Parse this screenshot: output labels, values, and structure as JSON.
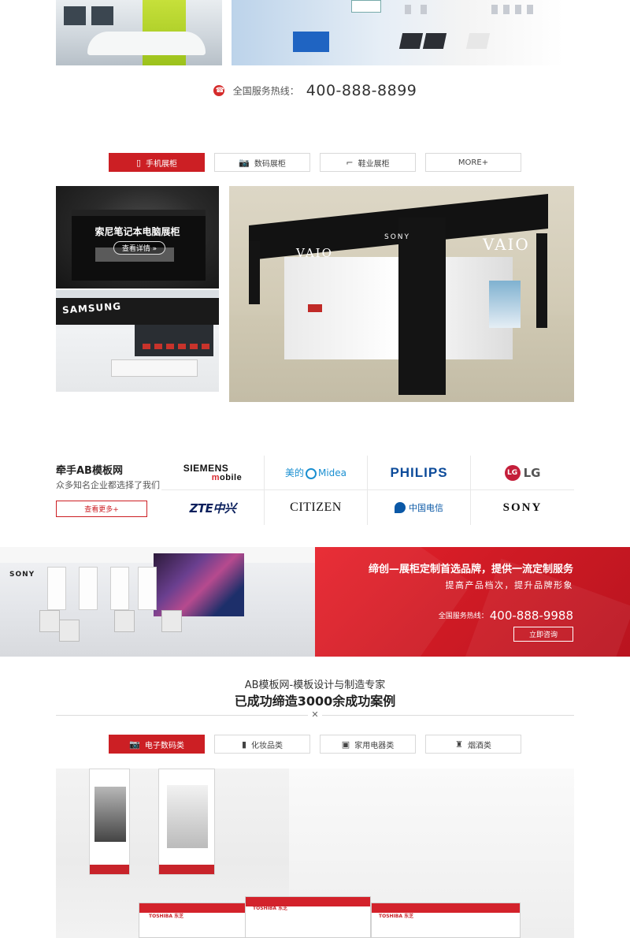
{
  "hotline": {
    "label": "全国服务热线：",
    "number": "400-888-8899"
  },
  "product_tabs": [
    {
      "label": "手机展柜",
      "icon": "mobile-phone-icon",
      "active": true
    },
    {
      "label": "数码展柜",
      "icon": "camera-icon",
      "active": false
    },
    {
      "label": "鞋业展柜",
      "icon": "high-heel-icon",
      "active": false
    },
    {
      "label": "MORE+",
      "icon": "",
      "active": false
    }
  ],
  "showcase": {
    "title": "索尼笔记本电脑展柜",
    "button": "查看详情 »",
    "side_brand": "SAMSUNG",
    "main_brand": "VAIO",
    "main_maker": "SONY"
  },
  "partners": {
    "title": "牵手AB模板网",
    "subtitle": "众多知名企业都选择了我们",
    "button": "查看更多+",
    "logos": {
      "siemens": "SIEMENS",
      "siemens_mobile_m": "m",
      "siemens_mobile_rest": "obile",
      "midea_cn": "美的",
      "midea_en": "Midea",
      "philips": "PHILIPS",
      "lg_mark": "LG",
      "lg": "LG",
      "zte": "ZTE中兴",
      "citizen": "CITIZEN",
      "telecom": "中国电信",
      "sony": "SONY"
    }
  },
  "banner": {
    "headline": "缔创—展柜定制首选品牌，提供一流定制服务",
    "subline": "提高产品档次，提升品牌形象",
    "hotline_label": "全国服务热线：",
    "hotline_number": "400-888-9988",
    "button": "立即咨询",
    "photo_brand": "SONY"
  },
  "cases": {
    "subtitle": "AB模板网-模板设计与制造专家",
    "title": "已成功缔造3000余成功案例",
    "divider_mark": "✕",
    "tabs": [
      {
        "label": "电子数码类",
        "icon": "camera-icon",
        "active": true
      },
      {
        "label": "化妆品类",
        "icon": "lipstick-icon",
        "active": false
      },
      {
        "label": "家用电器类",
        "icon": "appliance-icon",
        "active": false
      },
      {
        "label": "烟酒类",
        "icon": "bottle-icon",
        "active": false
      }
    ],
    "photo_brand": "TOSHIBA 东芝"
  },
  "colors": {
    "accent": "#cc1f24",
    "text": "#333333",
    "border": "#d9d9d9"
  }
}
